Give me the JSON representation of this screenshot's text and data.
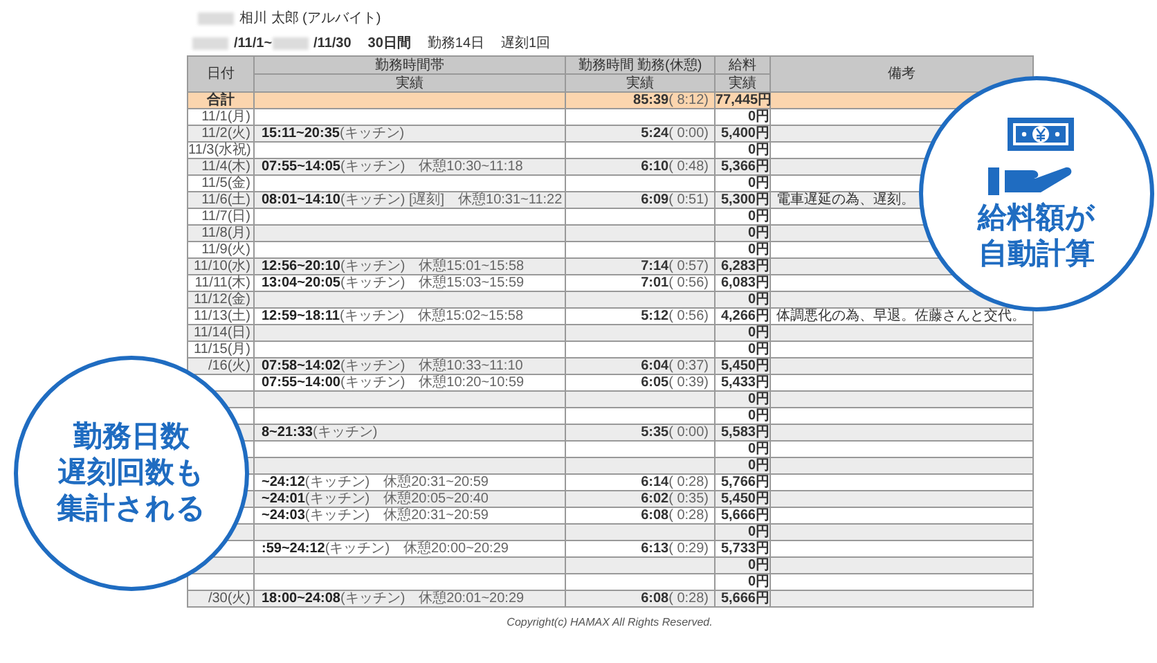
{
  "employee": {
    "name": "相川 太郎 (アルバイト)"
  },
  "period": {
    "start": "/11/1~",
    "end": "/11/30",
    "days": "30日間",
    "work_days": "勤務14日",
    "late": "遅刻1回"
  },
  "table": {
    "columns": [
      {
        "label": "日付"
      },
      {
        "label": "勤務時間帯",
        "sub": "実績"
      },
      {
        "label": "勤務時間 勤務(休憩)",
        "sub": "実績"
      },
      {
        "label": "給料",
        "sub": "実績"
      },
      {
        "label": "備考"
      }
    ],
    "total": {
      "label": "合計",
      "work": "85:39",
      "break": "( 8:12)",
      "pay": "77,445円"
    },
    "rows": [
      {
        "date": "11/1(月)",
        "pay": "0円"
      },
      {
        "date": "11/2(火)",
        "time": "15:11~20:35",
        "place": "(キッチン)",
        "work": "5:24",
        "break": "( 0:00)",
        "pay": "5,400円"
      },
      {
        "date": "11/3(水祝)",
        "pay": "0円"
      },
      {
        "date": "11/4(木)",
        "time": "07:55~14:05",
        "place": "(キッチン)",
        "rest": "休憩10:30~11:18",
        "work": "6:10",
        "break": "( 0:48)",
        "pay": "5,366円"
      },
      {
        "date": "11/5(金)",
        "pay": "0円"
      },
      {
        "date": "11/6(土)",
        "time": "08:01~14:10",
        "place": "(キッチン)",
        "tag": "[遅刻]",
        "rest": "休憩10:31~11:22",
        "work": "6:09",
        "break": "( 0:51)",
        "pay": "5,300円",
        "note": "電車遅延の為、遅刻。"
      },
      {
        "date": "11/7(日)",
        "pay": "0円"
      },
      {
        "date": "11/8(月)",
        "pay": "0円"
      },
      {
        "date": "11/9(火)",
        "pay": "0円"
      },
      {
        "date": "11/10(水)",
        "time": "12:56~20:10",
        "place": "(キッチン)",
        "rest": "休憩15:01~15:58",
        "work": "7:14",
        "break": "( 0:57)",
        "pay": "6,283円"
      },
      {
        "date": "11/11(木)",
        "time": "13:04~20:05",
        "place": "(キッチン)",
        "rest": "休憩15:03~15:59",
        "work": "7:01",
        "break": "( 0:56)",
        "pay": "6,083円"
      },
      {
        "date": "11/12(金)",
        "pay": "0円"
      },
      {
        "date": "11/13(土)",
        "time": "12:59~18:11",
        "place": "(キッチン)",
        "rest": "休憩15:02~15:58",
        "work": "5:12",
        "break": "( 0:56)",
        "pay": "4,266円",
        "note": "体調悪化の為、早退。佐藤さんと交代。"
      },
      {
        "date": "11/14(日)",
        "pay": "0円"
      },
      {
        "date": "11/15(月)",
        "pay": "0円"
      },
      {
        "date": "/16(火)",
        "time": "07:58~14:02",
        "place": "(キッチン)",
        "rest": "休憩10:33~11:10",
        "work": "6:04",
        "break": "( 0:37)",
        "pay": "5,450円"
      },
      {
        "time": "07:55~14:00",
        "place": "(キッチン)",
        "rest": "休憩10:20~10:59",
        "work": "6:05",
        "break": "( 0:39)",
        "pay": "5,433円"
      },
      {
        "pay": "0円"
      },
      {
        "pay": "0円"
      },
      {
        "time": "8~21:33",
        "place": "(キッチン)",
        "work": "5:35",
        "break": "( 0:00)",
        "pay": "5,583円"
      },
      {
        "pay": "0円"
      },
      {
        "pay": "0円"
      },
      {
        "time": "~24:12",
        "place": "(キッチン)",
        "rest": "休憩20:31~20:59",
        "work": "6:14",
        "break": "( 0:28)",
        "pay": "5,766円"
      },
      {
        "time": "~24:01",
        "place": "(キッチン)",
        "rest": "休憩20:05~20:40",
        "work": "6:02",
        "break": "( 0:35)",
        "pay": "5,450円"
      },
      {
        "time": "~24:03",
        "place": "(キッチン)",
        "rest": "休憩20:31~20:59",
        "work": "6:08",
        "break": "( 0:28)",
        "pay": "5,666円"
      },
      {
        "pay": "0円"
      },
      {
        "time": ":59~24:12",
        "place": "(キッチン)",
        "rest": "休憩20:00~20:29",
        "work": "6:13",
        "break": "( 0:29)",
        "pay": "5,733円"
      },
      {
        "pay": "0円"
      },
      {
        "pay": "0円"
      },
      {
        "date": "/30(火)",
        "time": "18:00~24:08",
        "place": "(キッチン)",
        "rest": "休憩20:01~20:29",
        "work": "6:08",
        "break": "( 0:28)",
        "pay": "5,666円"
      }
    ]
  },
  "footer": {
    "copyright": "Copyright(c) HAMAX All Rights Reserved."
  },
  "callouts": [
    {
      "kind": "salary",
      "lines": [
        "給料額が",
        "自動計算"
      ]
    },
    {
      "kind": "count",
      "lines": [
        "勤務日数",
        "遅刻回数も",
        "集計される"
      ]
    }
  ]
}
